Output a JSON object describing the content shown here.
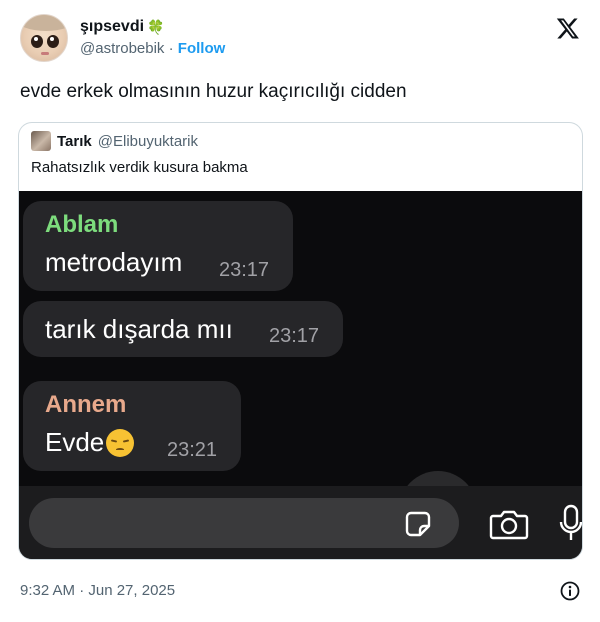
{
  "author": {
    "display_name": "şıpsevdi",
    "display_emoji": "🍀",
    "handle": "@astrobebik",
    "separator": "·",
    "follow_label": "Follow"
  },
  "brand_icon": "x-logo-icon",
  "tweet": {
    "text": "evde erkek olmasının huzur kaçırıcılığı cidden",
    "timestamp": "9:32 AM · Jun 27, 2025"
  },
  "quote": {
    "name": "Tarık",
    "handle": "@Elibuyuktarik",
    "text": "Rahatsızlık verdik kusura bakma",
    "chat": {
      "messages": [
        {
          "sender": "Ablam",
          "text": "metrodayım",
          "time": "23:17"
        },
        {
          "sender": "",
          "text": "tarık dışarda mıı",
          "time": "23:17"
        },
        {
          "sender": "Annem",
          "text": "Evde",
          "emoji": "pensive-face-icon",
          "time": "23:21"
        }
      ],
      "input_icons": [
        "sticker-icon",
        "camera-icon",
        "microphone-icon"
      ]
    }
  },
  "colors": {
    "follow": "#1d9bf0",
    "ablam_name": "#7ddc7d",
    "annem_name": "#e8a98c",
    "chat_background": "#0b0b0d",
    "bubble": "#262629"
  }
}
